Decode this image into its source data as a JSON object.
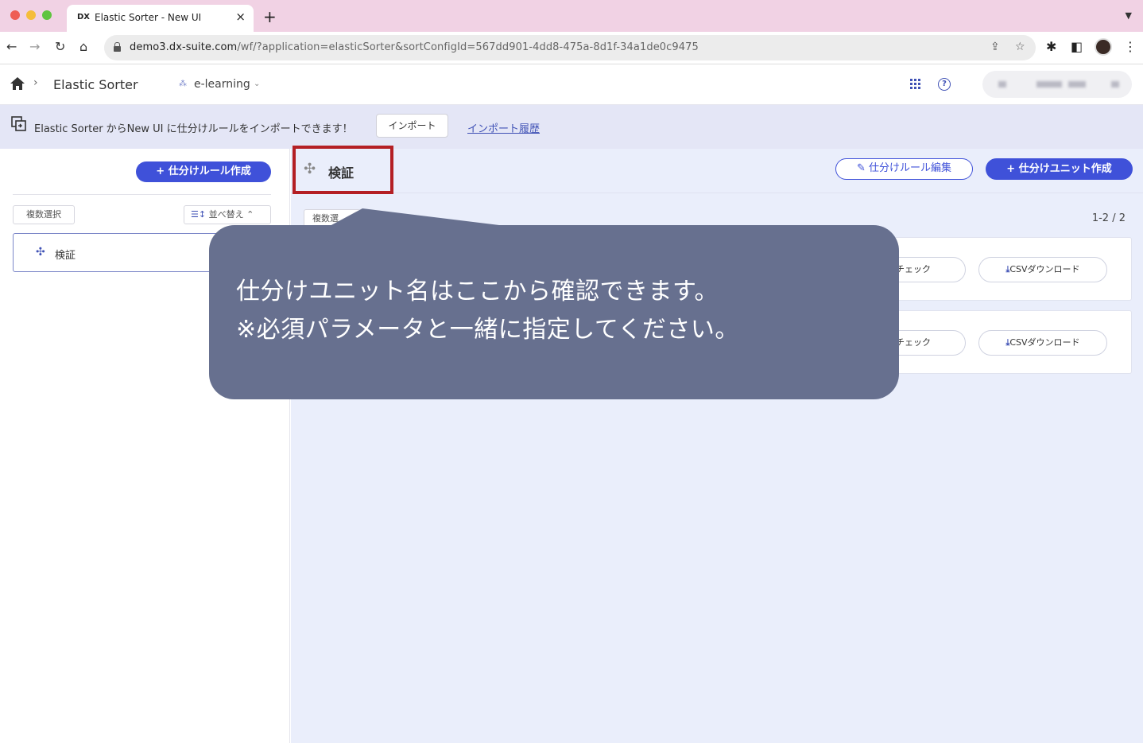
{
  "browser": {
    "tab": {
      "favicon": "DX",
      "title": "Elastic Sorter - New UI",
      "close": "×"
    },
    "new_tab": "+",
    "url_host": "demo3.dx-suite.com",
    "url_path": "/wf/?application=elasticSorter&sortConfigId=567dd901-4dd8-475a-8d1f-34a1de0c9475"
  },
  "header": {
    "app_title": "Elastic Sorter",
    "workspace": "e-learning"
  },
  "banner": {
    "text": "Elastic Sorter からNew UI に仕分けルールをインポートできます！",
    "import_button": "インポート",
    "history_link": "インポート履歴"
  },
  "sidebar": {
    "create_button": "+ 仕分けルール作成",
    "multi_select": "複数選択",
    "sort_button": "並べ替え",
    "items": [
      {
        "label": "検証"
      }
    ]
  },
  "main": {
    "title": "検証",
    "edit_button": "仕分けルール編集",
    "create_unit_button": "+ 仕分けユニット作成",
    "multi_select": "複数選",
    "pager": "1-2 / 2",
    "rows": [
      {
        "check_label": "チェック",
        "csv_label": "CSVダウンロード"
      },
      {
        "check_label": "チェック",
        "csv_label": "CSVダウンロード"
      }
    ]
  },
  "callout": {
    "line1": "仕分けユニット名はここから確認できます。",
    "line2": "※必須パラメータと一緒に指定してください。"
  },
  "colors": {
    "accent": "#3f51d9",
    "callout_bg": "#67708f",
    "highlight": "#b41f24",
    "banner_bg": "#e4e6f6"
  }
}
